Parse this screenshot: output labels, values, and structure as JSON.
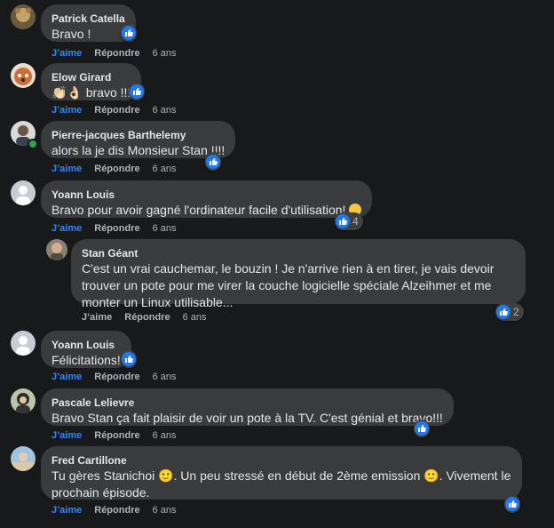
{
  "actions": {
    "like": "J’aime",
    "reply": "Répondre"
  },
  "comments": [
    {
      "name": "Patrick Catella",
      "text": "Bravo !",
      "time": "6 ans",
      "reactions": ""
    },
    {
      "name": "Elow Girard",
      "text": "👏🏻👌🏻 bravo !!!",
      "time": "6 ans",
      "reactions": ""
    },
    {
      "name": "Pierre-jacques Barthelemy",
      "text": "alors la je dis Monsieur Stan !!!!",
      "time": "6 ans",
      "reactions": ""
    },
    {
      "name": "Yoann Louis",
      "text": "Bravo pour avoir gagné l'ordinateur facile d'utilisation!",
      "time": "6 ans",
      "reactions": "4"
    },
    {
      "name": "Stan Géant",
      "text": "C'est un vrai cauchemar, le bouzin ! Je n'arrive rien à en tirer, je vais devoir trouver un pote pour me virer la couche logicielle spéciale Alzeihmer et me monter un Linux utilisable...",
      "time": "6 ans",
      "reactions": "2"
    },
    {
      "name": "Yoann Louis",
      "text": "Félicitations!",
      "time": "6 ans",
      "reactions": ""
    },
    {
      "name": "Pascale Lelievre",
      "text": "Bravo Stan ça fait plaisir de voir un pote à la TV. C'est génial et bravo!!!",
      "time": "6 ans",
      "reactions": ""
    },
    {
      "name": "Fred Cartillone",
      "text": "Tu gères Stanichoi 🙂. Un peu stressé en début de 2ème emission 🙂. Vivement le prochain épisode.",
      "time": "6 ans",
      "reactions": ""
    }
  ],
  "colors": {
    "background": "#18191a",
    "bubble": "#3a3b3c",
    "link": "#2d88ff",
    "like_badge": "#2078f4"
  },
  "icons": {
    "like": "thumbs-up-icon",
    "emoji": "smiley-icon"
  }
}
